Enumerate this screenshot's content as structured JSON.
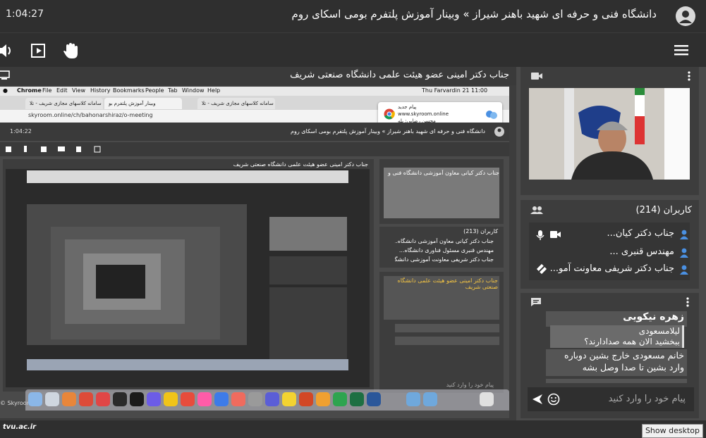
{
  "header": {
    "timer": "1:04:27",
    "title": "دانشگاه فنی و حرفه ای شهید باهنر شیراز » وبینار آموزش پلتفرم بومی اسکای روم"
  },
  "share": {
    "title": "جناب دکتر امینی عضو هیئت علمی دانشگاه صنعتی شریف"
  },
  "shot": {
    "mac_menu": [
      "Chrome",
      "File",
      "Edit",
      "View",
      "History",
      "Bookmarks",
      "People",
      "Tab",
      "Window",
      "Help"
    ],
    "clock": "Thu Farvardin 21  11:00",
    "tabs": [
      "سامانه کلاسهای مجازی شریف - تلا",
      "وبینار آموزش پلتفرم بو",
      "سامانه کلاسهای مجازی شریف - تلا"
    ],
    "url": "skyroom.online/ch/bahonarshiraz/o-meeting",
    "notification": {
      "title": "پیام جدید",
      "site": "www.skyroom.online",
      "body": "محسن رضایی: بله"
    },
    "inner_timer": "1:04:22",
    "inner_title": "دانشگاه فنی و حرفه ای شهید باهنر شیراز » وبینار آموزش پلتفرم بومی اسکای روم",
    "inner_share_title": "جناب دکتر امینی عضو هیئت علمی دانشگاه صنعتی شریف",
    "inner_video_caption": "جناب دکتر کیانی معاون آموزشی دانشگاه فنی و حرفه ای",
    "inner_users_count": "کاربران (213)",
    "inner_users": [
      "جناب دکتر کیانی معاون آموزشی دانشگاه...",
      "مهندس قنبری مسئول فناوری دانشگاه...",
      "جناب دکتر شریفی معاونت آموزشی دانشگاه استان فارس"
    ],
    "inner_chat": "جناب دکتر امینی عضو هیئت علمی دانشگاه صنعتی شریف",
    "inner_chat_placeholder": "پیام خود را وارد کنید",
    "skyroom_label": "© Skyroom™"
  },
  "video": {
    "label": "جناب دکتر کیانی معاون آموزشی دانشگاه فنی و حرفه ای"
  },
  "users": {
    "title": "کاربران (214)",
    "list": [
      {
        "name": "جناب دکتر کیان..."
      },
      {
        "name": "مهندس قنبری ..."
      },
      {
        "name": "جناب دکتر شریفی معاونت آمو..."
      }
    ]
  },
  "chat": {
    "sender": "زهره نیکویی",
    "msg1_sender": "لیلامسعودی",
    "msg1_text": "ببخشید الان همه صدادارند؟",
    "msg2_text": "خانم مسعودی خارج بشین دوباره وارد بشین تا صدا وصل بشه",
    "placeholder": "پیام خود را وارد کنید"
  },
  "footer": {
    "watermark": "tvu.ac.ir",
    "show_desktop": "Show desktop"
  },
  "colors": {
    "accent_blue": "#4a90e2",
    "dark_bar": "#2f2f2f",
    "panel": "#3d3d3d",
    "chat_yellow": "#f5c542"
  }
}
